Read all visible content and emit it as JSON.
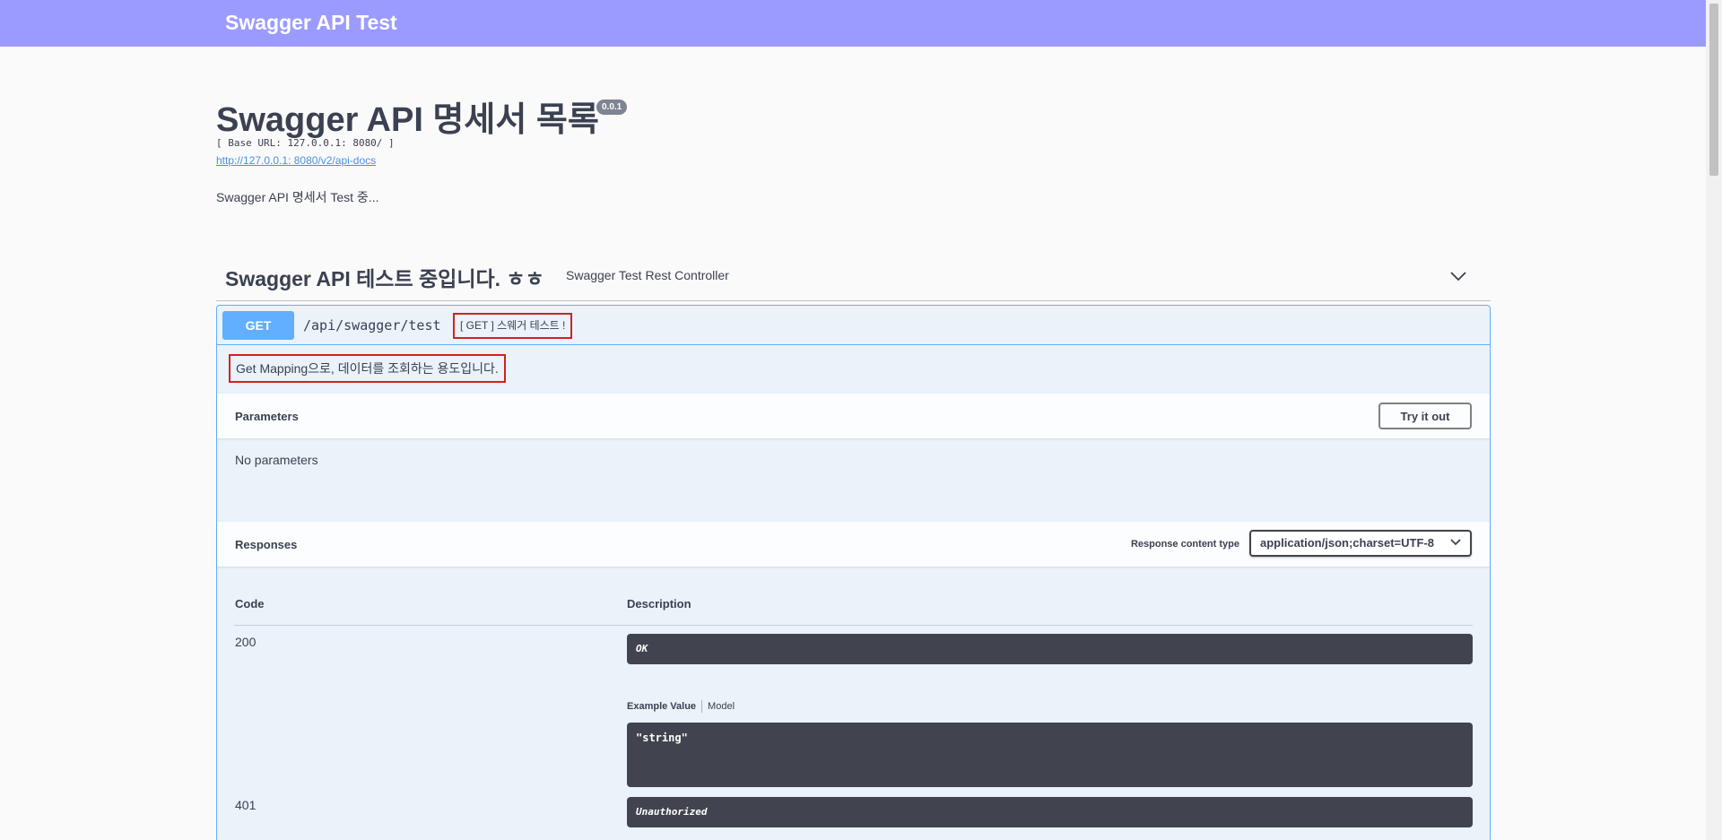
{
  "topbar": {
    "title": "Swagger API Test"
  },
  "info": {
    "title": "Swagger API 명세서 목록",
    "version": "0.0.1",
    "base_url": "[ Base URL: 127.0.0.1: 8080/ ]",
    "api_docs_link": "http://127.0.0.1: 8080/v2/api-docs",
    "description": "Swagger API 명세서 Test 중..."
  },
  "tag": {
    "name": "Swagger API 테스트 중입니다. ㅎㅎ",
    "description": "Swagger Test Rest Controller",
    "chevron_icon": "chevron-down-icon"
  },
  "operation": {
    "method": "GET",
    "path": "/api/swagger/test",
    "summary": "[ GET ] 스웨거 테스트 !",
    "description": "Get Mapping으로, 데이터를 조회하는 용도입니다.",
    "highlight_color": "#d0231f",
    "method_color": "#61affe"
  },
  "parameters": {
    "title": "Parameters",
    "try_button": "Try it out",
    "empty_text": "No parameters"
  },
  "responses": {
    "title": "Responses",
    "content_type_label": "Response content type",
    "content_type_value": "application/json;charset=UTF-8",
    "columns": {
      "code": "Code",
      "description": "Description"
    },
    "rows": [
      {
        "code": "200",
        "description": "OK",
        "example_tabs": {
          "active": "Example Value",
          "other": "Model"
        },
        "example_value": "\"string\""
      },
      {
        "code": "401",
        "description": "Unauthorized"
      }
    ]
  },
  "colors": {
    "topbar": "#9b9bff",
    "text": "#3b4151",
    "code_box": "#41444e"
  }
}
